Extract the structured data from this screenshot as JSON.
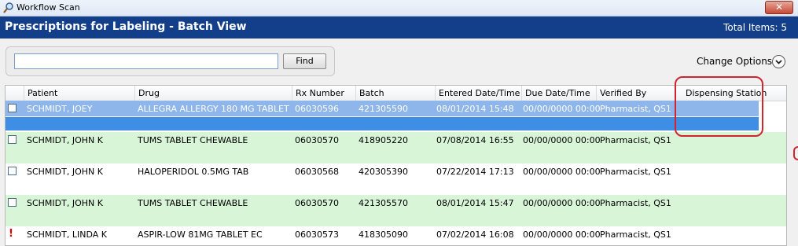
{
  "window": {
    "title": "Workflow Scan",
    "close_label": "✕"
  },
  "header": {
    "title": "Prescriptions for Labeling - Batch View",
    "total_items": "Total Items: 5"
  },
  "search": {
    "value": "",
    "find_label": "Find"
  },
  "options": {
    "change_options_label": "Change Options:"
  },
  "columns": [
    "Patient",
    "Drug",
    "Rx Number",
    "Batch",
    "Entered Date/Time",
    "Due Date/Time",
    "Verified By",
    "Dispensing Station"
  ],
  "rows": [
    {
      "patient": "SCHMIDT, JOEY",
      "drug": "ALLEGRA ALLERGY 180 MG TABLET",
      "rx": "06030596",
      "batch": "421305590",
      "entered": "08/01/2014 15:48",
      "due": "00/00/0000 00:00",
      "verified": "Pharmacist, QS1",
      "station": "",
      "selected": true,
      "flag": "checkbox"
    },
    {
      "patient": "SCHMIDT, JOHN K",
      "drug": "TUMS TABLET CHEWABLE",
      "rx": "06030570",
      "batch": "418905220",
      "entered": "07/08/2014 16:55",
      "due": "00/00/0000 00:00",
      "verified": "Pharmacist, QS1",
      "station": "",
      "selected": false,
      "flag": "checkbox"
    },
    {
      "patient": "SCHMIDT, JOHN K",
      "drug": "HALOPERIDOL 0.5MG TAB",
      "rx": "06030568",
      "batch": "420305390",
      "entered": "07/22/2014 17:13",
      "due": "00/00/0000 00:00",
      "verified": "Pharmacist, QS1",
      "station": "",
      "selected": false,
      "flag": "checkbox"
    },
    {
      "patient": "SCHMIDT, JOHN K",
      "drug": "TUMS TABLET CHEWABLE",
      "rx": "06030570",
      "batch": "421305570",
      "entered": "08/01/2014 15:47",
      "due": "00/00/0000 00:00",
      "verified": "Pharmacist, QS1",
      "station": "",
      "selected": false,
      "flag": "checkbox"
    },
    {
      "patient": "SCHMIDT, LINDA K",
      "drug": "ASPIR-LOW 81MG TABLET EC",
      "rx": "06030573",
      "batch": "418305090",
      "entered": "07/02/2014 16:08",
      "due": "00/00/0000 00:00",
      "verified": "Pharmacist, QS1",
      "station": "",
      "selected": false,
      "flag": "alert"
    }
  ],
  "colors": {
    "header_bg": "#133f8a",
    "selected_row": "#8fb6ea",
    "selected_row_band": "#3f8ee6",
    "green_row": "#d8f5d8",
    "white_row": "#ffffff",
    "highlight_ring": "#d2242f"
  },
  "icons": {
    "app": "magnifier-icon",
    "options": "chevron-down-icon",
    "flag": "exclamation-icon"
  }
}
